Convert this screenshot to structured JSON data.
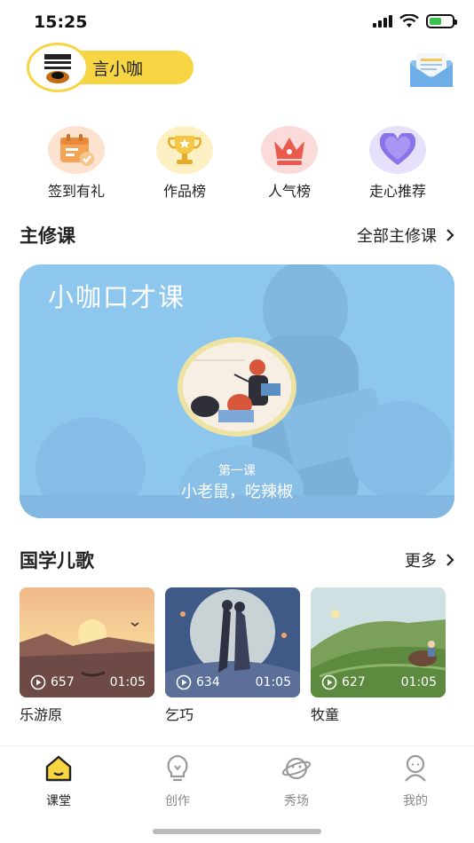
{
  "status_bar": {
    "time": "15:25"
  },
  "header": {
    "username": "言小咖"
  },
  "quick_entries": [
    {
      "label": "签到有礼",
      "icon": "calendar-check-icon",
      "color": "#f4a460"
    },
    {
      "label": "作品榜",
      "icon": "trophy-icon",
      "color": "#f6c744"
    },
    {
      "label": "人气榜",
      "icon": "crown-icon",
      "color": "#ea5b4f"
    },
    {
      "label": "走心推荐",
      "icon": "heart-icon",
      "color": "#8a73e8"
    }
  ],
  "main_course": {
    "section_title": "主修课",
    "more_label": "全部主修课",
    "banner_title": "小咖口才课",
    "lesson_number": "第一课",
    "lesson_title": "小老鼠，吃辣椒"
  },
  "songs": {
    "section_title": "国学儿歌",
    "more_label": "更多",
    "items": [
      {
        "name": "乐游原",
        "plays": "657",
        "duration": "01:05"
      },
      {
        "name": "乞巧",
        "plays": "634",
        "duration": "01:05"
      },
      {
        "name": "牧童",
        "plays": "627",
        "duration": "01:05"
      }
    ]
  },
  "tabbar": {
    "items": [
      {
        "label": "课堂",
        "icon": "home-icon",
        "active": true
      },
      {
        "label": "创作",
        "icon": "lightbulb-icon",
        "active": false
      },
      {
        "label": "秀场",
        "icon": "planet-icon",
        "active": false
      },
      {
        "label": "我的",
        "icon": "person-icon",
        "active": false
      }
    ]
  },
  "colors": {
    "accent": "#f8d542",
    "banner": "#8ec7ee"
  }
}
